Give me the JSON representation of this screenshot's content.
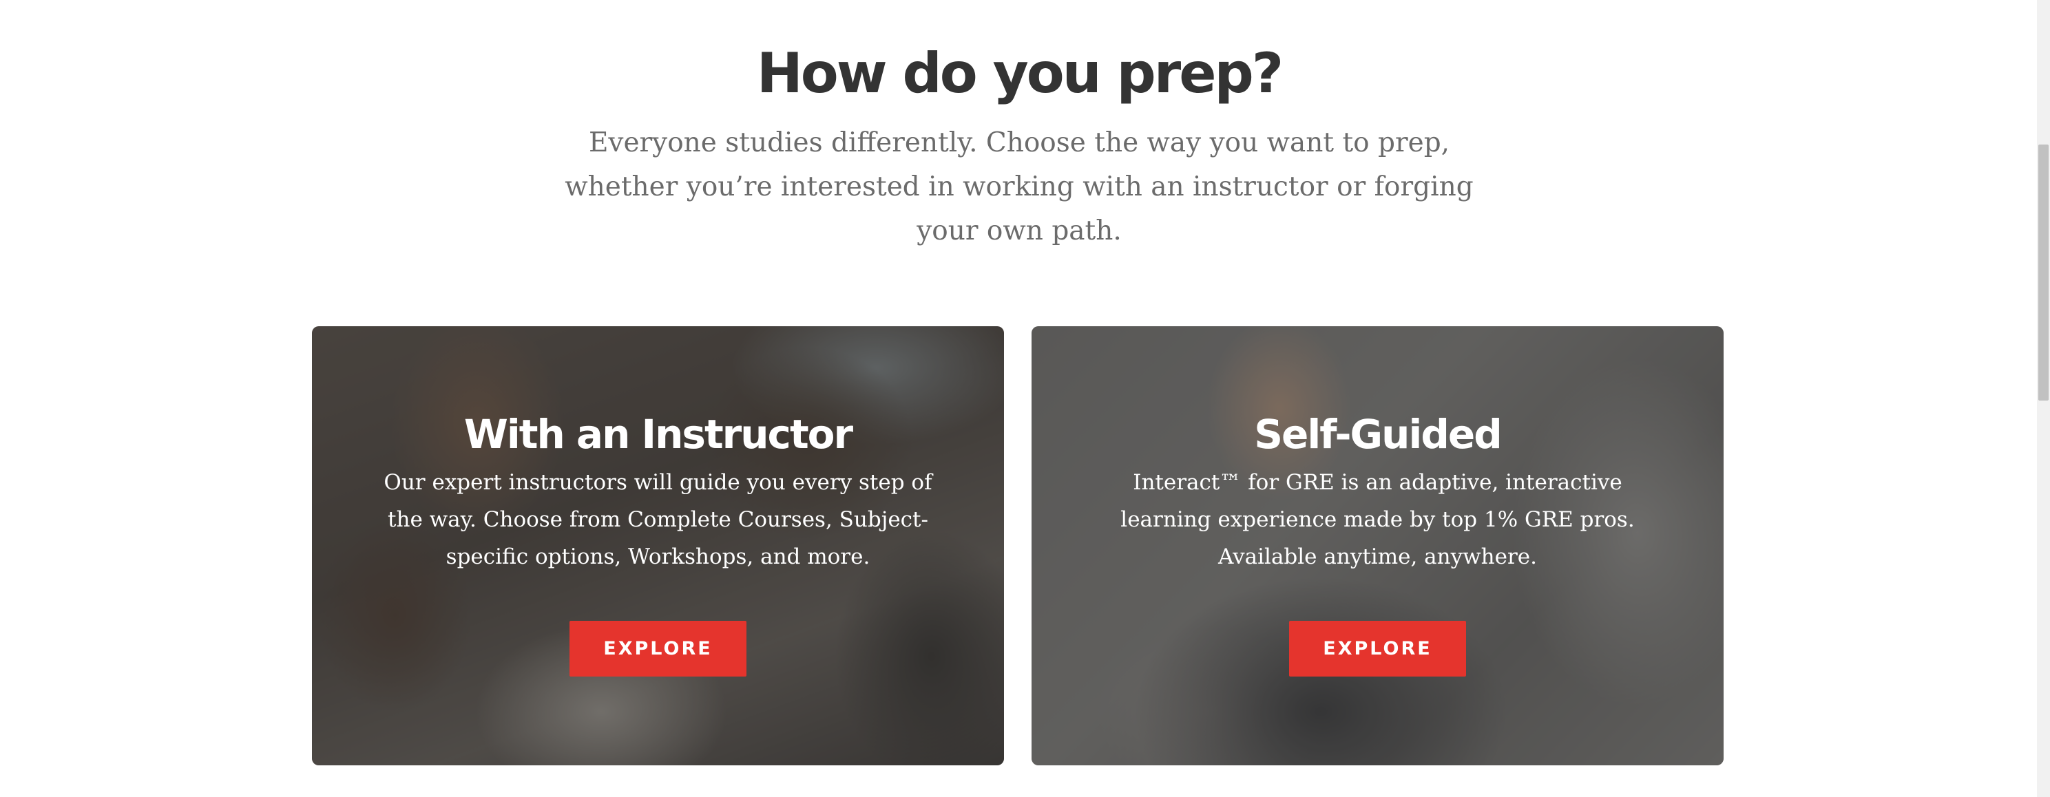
{
  "section": {
    "title": "How do you prep?",
    "subtitle": "Everyone studies differently. Choose the way you want to prep, whether you’re interested in working with an instructor or forging your own path."
  },
  "cards": [
    {
      "title": "With an Instructor",
      "description": "Our expert instructors will guide you every step of the way. Choose from Complete Courses, Subject-specific options, Workshops, and more.",
      "button_label": "EXPLORE"
    },
    {
      "title": "Self-Guided",
      "description": "Interact™ for GRE is an adaptive, interactive learning experience made by top 1% GRE pros. Available anytime, anywhere.",
      "button_label": "EXPLORE"
    }
  ],
  "colors": {
    "accent": "#e5342d",
    "heading": "#333333",
    "body_text": "#6b6b6b"
  }
}
